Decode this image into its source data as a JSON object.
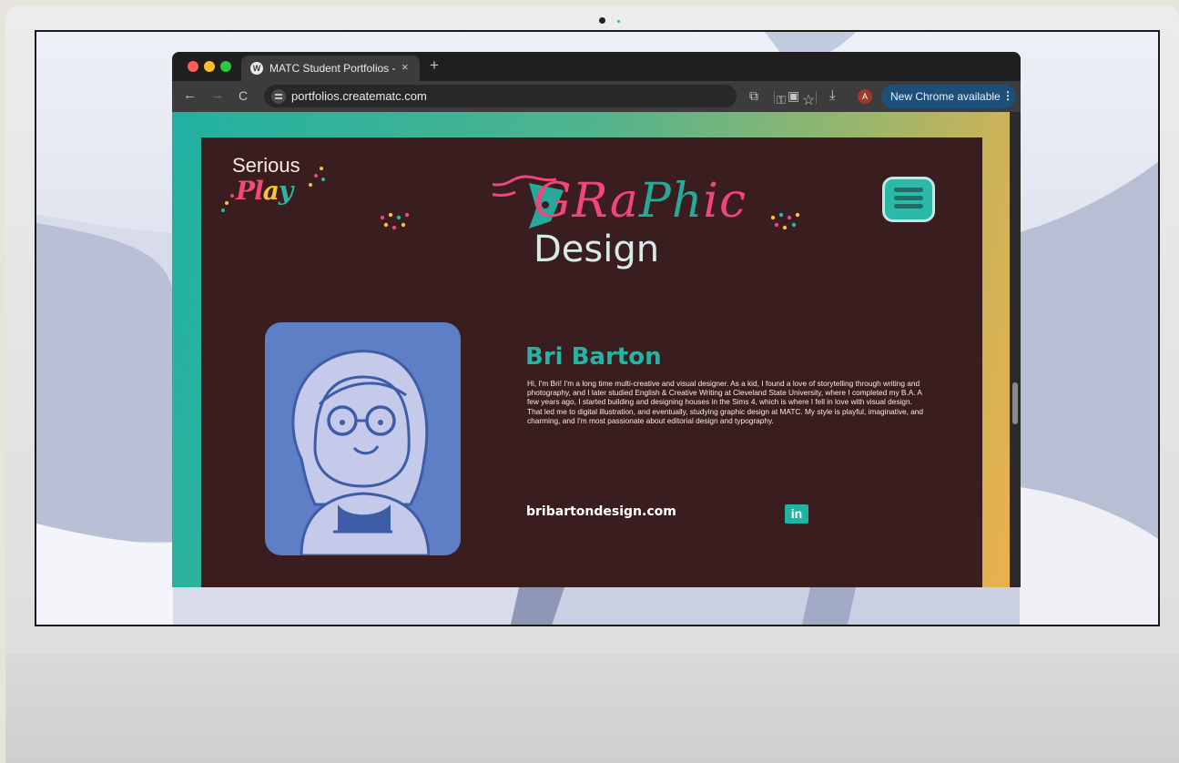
{
  "browser": {
    "tab_title": "MATC Student Portfolios -",
    "tab_close": "×",
    "new_tab": "+",
    "url": "portfolios.creatematc.com",
    "update_label": "New Chrome available",
    "update_menu": "⋮",
    "avatar_initial": "A",
    "nav": {
      "back": "←",
      "forward": "→",
      "reload": "C"
    }
  },
  "site": {
    "logo": {
      "line1": "Serious",
      "line2_p": "P",
      "line2_l": "l",
      "line2_a": "a",
      "line2_y": "y"
    },
    "header": {
      "graphic_a": "G",
      "graphic_b": "Ra",
      "graphic_c": "Ph",
      "graphic_d": "ic",
      "design": "Design"
    },
    "profile": {
      "name": "Bri Barton",
      "bio": "Hi, I'm Bri! I'm a long time multi-creative and visual designer. As a kid, I found a love of storytelling through writing and photography, and I later studied English & Creative Writing at Cleveland State University, where I completed my B.A. A few years ago, I started building and designing houses in the Sims 4, which is where I fell in love with visual design. That led me to digital illustration, and eventually, studying graphic design at MATC.  My style is playful, imaginative, and charming, and I'm most passionate about editorial design and typography.",
      "website": "bribartondesign.com",
      "linkedin": "in"
    }
  },
  "colors": {
    "panel": "#3a1d1f",
    "teal": "#27b3a3",
    "pink": "#f0467b",
    "portrait_bg": "#5e7ec5"
  },
  "icons": [
    "wordpress-icon",
    "site-info-icon",
    "key-icon",
    "star-icon",
    "extensions-icon",
    "tab-search-icon",
    "download-icon",
    "menu-icon",
    "linkedin-icon"
  ]
}
